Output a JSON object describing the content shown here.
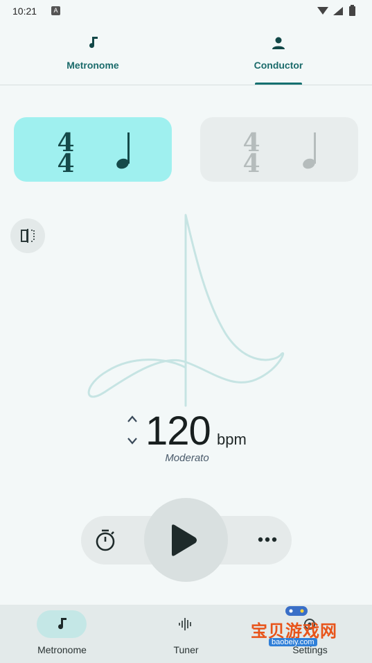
{
  "status": {
    "time": "10:21",
    "badge": "A",
    "icons": "▾◢▮"
  },
  "top_tabs": [
    {
      "label": "Metronome",
      "icon": "music-note-icon",
      "active": false
    },
    {
      "label": "Conductor",
      "icon": "person-icon",
      "active": true
    }
  ],
  "time_signatures": [
    {
      "top": "4",
      "bottom": "4",
      "note": "quarter-note-icon",
      "active": true
    },
    {
      "top": "4",
      "bottom": "4",
      "note": "quarter-note-icon",
      "active": false
    }
  ],
  "tempo": {
    "value": "120",
    "unit": "bpm",
    "marking": "Moderato"
  },
  "controls": {
    "timer_icon": "stopwatch-icon",
    "play_icon": "play-icon",
    "more_icon": "more-icon"
  },
  "bottom_nav": [
    {
      "label": "Metronome",
      "icon": "music-note-icon",
      "active": true
    },
    {
      "label": "Tuner",
      "icon": "waveform-icon",
      "active": false
    },
    {
      "label": "Settings",
      "icon": "gear-icon",
      "active": false
    }
  ],
  "watermark": {
    "text": "宝贝游戏网",
    "url": "baobeiy.com"
  },
  "colors": {
    "accent": "#157070",
    "active_card": "#9ff0ef",
    "background": "#f3f8f8"
  }
}
